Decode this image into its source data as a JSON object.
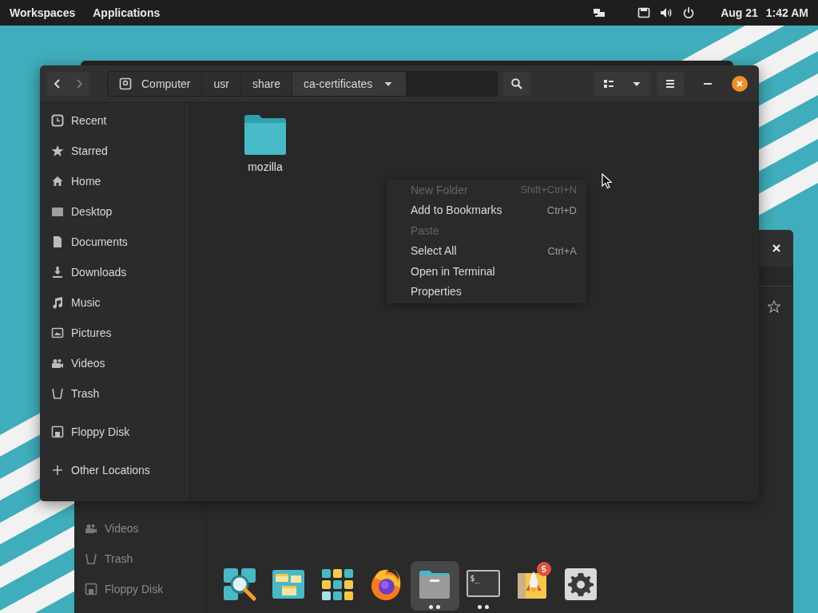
{
  "top_bar": {
    "menus": [
      {
        "label": "Workspaces"
      },
      {
        "label": "Applications"
      }
    ],
    "date": "Aug 21",
    "time": "1:42 AM"
  },
  "background_window": {
    "sidebar": [
      {
        "label": "Videos",
        "kind": "videos"
      },
      {
        "label": "Trash",
        "kind": "trash"
      },
      {
        "label": "Floppy Disk",
        "kind": "floppy"
      }
    ]
  },
  "file_window": {
    "navigation": {
      "back_disabled": false,
      "forward_disabled": true
    },
    "path": [
      {
        "label": "Computer",
        "kind": "drive",
        "selected": false
      },
      {
        "label": "usr",
        "kind": "folder",
        "selected": false
      },
      {
        "label": "share",
        "kind": "folder",
        "selected": false
      },
      {
        "label": "ca-certificates",
        "kind": "folder",
        "selected": true
      }
    ],
    "sidebar": {
      "sections": [
        [
          {
            "label": "Recent",
            "kind": "recent"
          },
          {
            "label": "Starred",
            "kind": "starred"
          },
          {
            "label": "Home",
            "kind": "home"
          },
          {
            "label": "Desktop",
            "kind": "desktop"
          },
          {
            "label": "Documents",
            "kind": "documents"
          },
          {
            "label": "Downloads",
            "kind": "downloads"
          },
          {
            "label": "Music",
            "kind": "music"
          },
          {
            "label": "Pictures",
            "kind": "pictures"
          },
          {
            "label": "Videos",
            "kind": "videos"
          },
          {
            "label": "Trash",
            "kind": "trash"
          }
        ],
        [
          {
            "label": "Floppy Disk",
            "kind": "floppy"
          }
        ],
        [
          {
            "label": "Other Locations",
            "kind": "other"
          }
        ]
      ]
    },
    "files": [
      {
        "name": "mozilla",
        "kind": "folder"
      }
    ]
  },
  "context_menu": [
    {
      "label": "New Folder",
      "shortcut": "Shift+Ctrl+N",
      "disabled": true
    },
    {
      "label": "Add to Bookmarks",
      "shortcut": "Ctrl+D",
      "disabled": false
    },
    {
      "label": "Paste",
      "disabled": true
    },
    {
      "label": "Select All",
      "shortcut": "Ctrl+A",
      "disabled": false
    },
    {
      "label": "Open in Terminal",
      "disabled": false
    },
    {
      "label": "Properties",
      "disabled": false
    }
  ],
  "dock": [
    {
      "kind": "search",
      "selected": false,
      "running": false
    },
    {
      "kind": "workspaces",
      "selected": false,
      "running": false
    },
    {
      "kind": "apps",
      "selected": false,
      "running": false
    },
    {
      "kind": "browser",
      "selected": false,
      "running": false
    },
    {
      "kind": "files",
      "selected": true,
      "running": true
    },
    {
      "kind": "terminal",
      "prompt": "$_",
      "selected": false,
      "running": true
    },
    {
      "kind": "shop",
      "badge": "5",
      "selected": false,
      "running": false
    },
    {
      "kind": "settings",
      "selected": false,
      "running": false
    }
  ]
}
